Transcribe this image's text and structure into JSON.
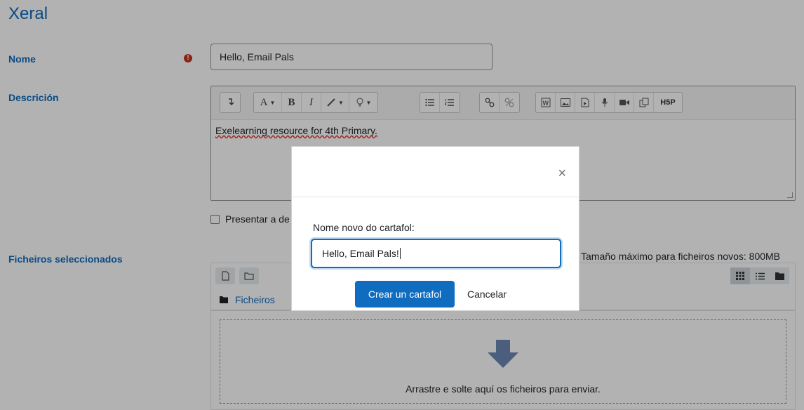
{
  "section": {
    "title": "Xeral"
  },
  "name_field": {
    "label": "Nome",
    "value": "Hello, Email Pals"
  },
  "description": {
    "label": "Descrición",
    "content": "Exelearning resource for 4th Primary.",
    "toolbar": {
      "font_label": "A",
      "bold_label": "B",
      "italic_label": "I",
      "h5p_label": "H5P"
    }
  },
  "show_description_label": "Presentar a de",
  "files": {
    "label": "Ficheiros seleccionados",
    "max_size": "Tamaño máximo para ficheiros novos: 800MB",
    "path_label": "Ficheiros",
    "drop_text": "Arrastre e solte aquí os ficheiros para enviar."
  },
  "modal": {
    "label": "Nome novo do cartafol:",
    "input_value": "Hello, Email Pals!",
    "close_symbol": "×",
    "create_label": "Crear un cartafol",
    "cancel_label": "Cancelar"
  },
  "colors": {
    "accent": "#0f6cbf",
    "required": "#ca3120",
    "overlay": "rgba(0,0,0,0.3)"
  }
}
